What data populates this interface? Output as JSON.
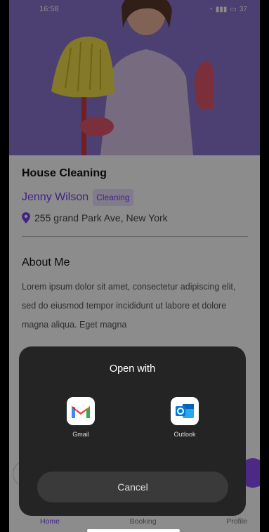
{
  "status_bar": {
    "time": "16:58",
    "battery": "37"
  },
  "service": {
    "title": "House Cleaning",
    "provider_name": "Jenny Wilson",
    "category_badge": "Cleaning",
    "address": "255 grand Park Ave, New York"
  },
  "about": {
    "title": "About Me",
    "text": "Lorem ipsum dolor sit amet, consectetur adipiscing elit, sed do eiusmod tempor incididunt ut labore et dolore magna aliqua. Eget magna"
  },
  "bottom_nav": {
    "home": "Home",
    "booking": "Booking",
    "profile": "Profile"
  },
  "open_with_dialog": {
    "title": "Open with",
    "apps": [
      {
        "label": "Gmail",
        "icon": "gmail-icon"
      },
      {
        "label": "Outlook",
        "icon": "outlook-icon"
      }
    ],
    "cancel_label": "Cancel"
  },
  "colors": {
    "accent": "#7a3ff0",
    "hero_bg": "#8b74cf",
    "sheet_bg": "#242424"
  }
}
